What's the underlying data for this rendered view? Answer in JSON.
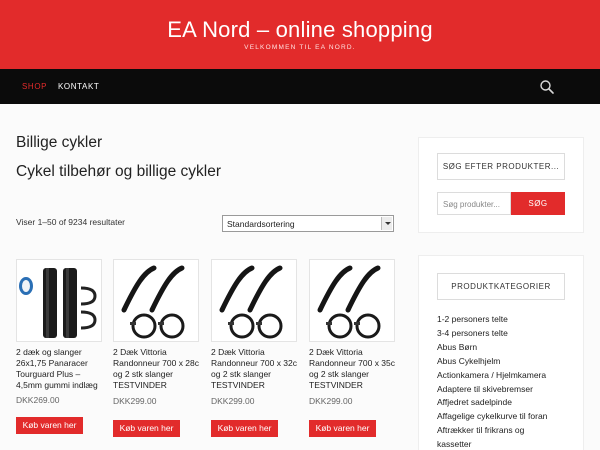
{
  "header": {
    "title": "EA Nord – online shopping",
    "tagline": "VELKOMMEN TIL EA NORD."
  },
  "nav": {
    "items": [
      {
        "label": "SHOP",
        "active": true
      },
      {
        "label": "KONTAKT",
        "active": false
      }
    ],
    "search_icon": "search-icon"
  },
  "main": {
    "title": "Billige cykler",
    "subtitle": "Cykel tilbehør og billige cykler",
    "result_count": "Viser 1–50 of 9234 resultater",
    "sort": {
      "selected": "Standardsortering"
    }
  },
  "products": [
    {
      "name": "2 dæk og slanger 26x1,75 Panaracer Tourguard Plus – 4,5mm gummi indlæg",
      "price": "DKK269.00",
      "button": "Køb varen her"
    },
    {
      "name": "2 Dæk Vittoria Randonneur 700 x 28c og 2 stk slanger TESTVINDER",
      "price": "DKK299.00",
      "button": "Køb varen her"
    },
    {
      "name": "2 Dæk Vittoria Randonneur 700 x 32c og 2 stk slanger TESTVINDER",
      "price": "DKK299.00",
      "button": "Køb varen her"
    },
    {
      "name": "2 Dæk Vittoria Randonneur 700 x 35c og 2 stk slanger TESTVINDER",
      "price": "DKK299.00",
      "button": "Køb varen her"
    }
  ],
  "sidebar": {
    "search": {
      "title": "SØG EFTER PRODUKTER...",
      "placeholder": "Søg produkter...",
      "button": "SØG"
    },
    "categories": {
      "title": "PRODUKTKATEGORIER",
      "items": [
        "1-2 personers telte",
        "3-4 personers telte",
        "Abus Børn",
        "Abus Cykelhjelm",
        "Actionkamera / Hjelmkamera",
        "Adaptere til skivebremser",
        "Affjedret sadelpinde",
        "Affagelige cykelkurve til foran",
        "Aftrækker til frikrans og",
        "kassetter"
      ]
    }
  },
  "colors": {
    "accent": "#e22b2b",
    "nav_bg": "#0b0b0b",
    "page_bg": "#fbfbfb"
  }
}
